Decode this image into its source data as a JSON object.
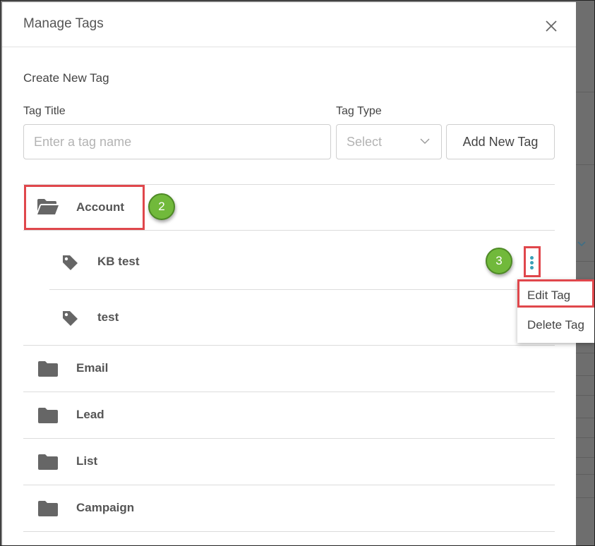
{
  "modal": {
    "title": "Manage Tags",
    "close_label": "Close"
  },
  "create": {
    "section_title": "Create New Tag",
    "tag_title_label": "Tag Title",
    "tag_title_placeholder": "Enter a tag name",
    "tag_title_value": "",
    "tag_type_label": "Tag Type",
    "tag_type_selected": "Select",
    "add_button_label": "Add New Tag"
  },
  "folders": [
    {
      "name": "Account",
      "expanded": true
    },
    {
      "name": "Email",
      "expanded": false
    },
    {
      "name": "Lead",
      "expanded": false
    },
    {
      "name": "List",
      "expanded": false
    },
    {
      "name": "Campaign",
      "expanded": false
    }
  ],
  "account_tags": [
    {
      "name": "KB test"
    },
    {
      "name": "test"
    }
  ],
  "menu": {
    "items": [
      "Edit Tag",
      "Delete Tag"
    ]
  },
  "annotations": {
    "step_2": "2",
    "step_3": "3",
    "highlight_color": "#e0474c",
    "badge_color": "#71b93b"
  },
  "icons": {
    "folder_open": "folder-open-icon",
    "folder": "folder-icon",
    "tag": "tag-icon",
    "close": "close-icon",
    "chevron": "chevron-down-icon",
    "kebab": "kebab-menu-icon"
  }
}
